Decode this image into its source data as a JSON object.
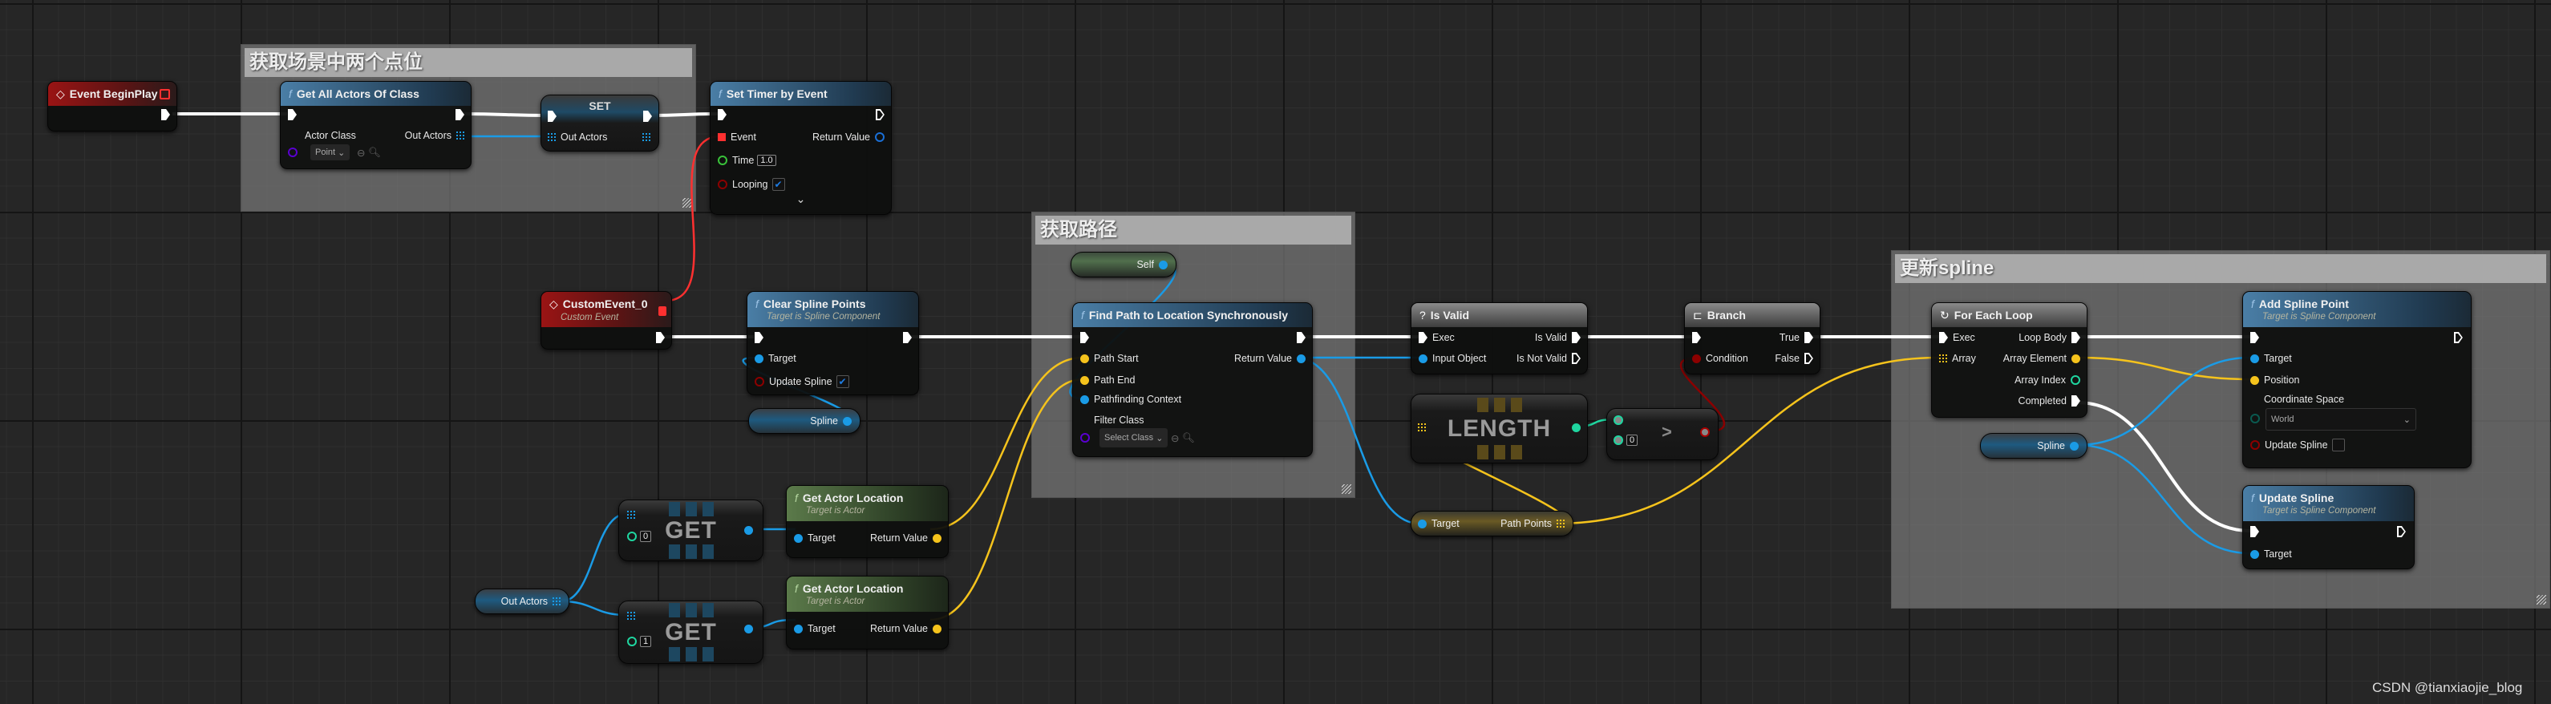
{
  "comments": [
    {
      "title": "获取场景中两个点位"
    },
    {
      "title": "获取路径"
    },
    {
      "title": "更新spline"
    }
  ],
  "begin_play": {
    "title": "Event BeginPlay"
  },
  "get_all_actors": {
    "title": "Get All Actors Of Class",
    "actor_class": "Actor Class",
    "class_value": "Point",
    "out_actors": "Out Actors"
  },
  "set_node": {
    "title": "SET",
    "out_actors": "Out Actors"
  },
  "set_timer": {
    "title": "Set Timer by Event",
    "event": "Event",
    "return_value": "Return Value",
    "time": "Time",
    "time_value": "1.0",
    "looping": "Looping",
    "looping_checked": true,
    "expand": "⌄"
  },
  "custom_event": {
    "title": "CustomEvent_0",
    "subtitle": "Custom Event"
  },
  "clear_spline": {
    "title": "Clear Spline Points",
    "subtitle": "Target is Spline Component",
    "target": "Target",
    "update_spline": "Update Spline",
    "update_checked": true
  },
  "spline_var_left": {
    "label": "Spline"
  },
  "self_node": {
    "label": "Self"
  },
  "find_path": {
    "title": "Find Path to Location Synchronously",
    "path_start": "Path Start",
    "path_end": "Path End",
    "context": "Pathfinding Context",
    "filter_class": "Filter Class",
    "filter_value": "Select Class",
    "return_value": "Return Value"
  },
  "is_valid": {
    "title": "Is Valid",
    "exec": "Exec",
    "is_valid": "Is Valid",
    "input_object": "Input Object",
    "is_not_valid": "Is Not Valid"
  },
  "branch": {
    "title": "Branch",
    "true": "True",
    "condition": "Condition",
    "false": "False"
  },
  "length_node": {
    "label": "LENGTH"
  },
  "greater_node": {
    "op": ">",
    "value": "0"
  },
  "path_points": {
    "target": "Target",
    "label": "Path Points"
  },
  "for_each": {
    "title": "For Each Loop",
    "exec": "Exec",
    "loop_body": "Loop Body",
    "array": "Array",
    "array_element": "Array Element",
    "array_index": "Array Index",
    "completed": "Completed"
  },
  "spline_var_right": {
    "label": "Spline"
  },
  "add_spline_point": {
    "title": "Add Spline Point",
    "subtitle": "Target is Spline Component",
    "target": "Target",
    "position": "Position",
    "coord_space": "Coordinate Space",
    "coord_value": "World",
    "update_spline": "Update Spline",
    "update_checked": false
  },
  "update_spline": {
    "title": "Update Spline",
    "subtitle": "Target is Spline Component",
    "target": "Target"
  },
  "out_actors_var": {
    "label": "Out Actors"
  },
  "get0": {
    "label": "GET",
    "index": "0"
  },
  "get1": {
    "label": "GET",
    "index": "1"
  },
  "get_actor_location_1": {
    "title": "Get Actor Location",
    "subtitle": "Target is Actor",
    "target": "Target",
    "return_value": "Return Value"
  },
  "get_actor_location_2": {
    "title": "Get Actor Location",
    "subtitle": "Target is Actor",
    "target": "Target",
    "return_value": "Return Value"
  },
  "watermark": "CSDN @tianxiaojie_blog",
  "colors": {
    "exec": "#ffffff",
    "object": "#1a9be6",
    "vector": "#f5c31c",
    "bool": "#8c0000",
    "int": "#1fd6a0",
    "float": "#39c23a",
    "class": "#5a00d0",
    "delegate": "#ff3030"
  }
}
